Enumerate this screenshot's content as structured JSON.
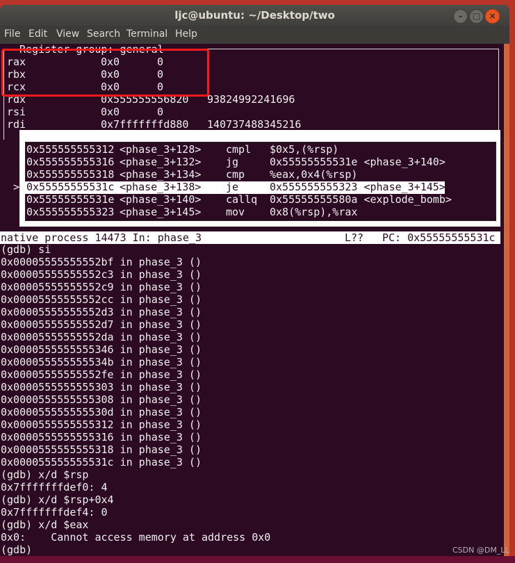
{
  "window": {
    "title": "ljc@ubuntu: ~/Desktop/two",
    "buttons": [
      "minimize",
      "maximize",
      "close"
    ],
    "close_color": "#e95420"
  },
  "menu": [
    "File",
    "Edit",
    "View",
    "Search",
    "Terminal",
    "Help"
  ],
  "registers": {
    "header": "Register group: general",
    "rows": [
      {
        "name": "rax",
        "hex": "0x0",
        "dec": "0"
      },
      {
        "name": "rbx",
        "hex": "0x0",
        "dec": "0"
      },
      {
        "name": "rcx",
        "hex": "0x0",
        "dec": "0"
      },
      {
        "name": "rdx",
        "hex": "0x555555556820",
        "dec": "93824992241696"
      },
      {
        "name": "rsi",
        "hex": "0x0",
        "dec": "0"
      },
      {
        "name": "rdi",
        "hex": "0x7fffffffd880",
        "dec": "140737488345216"
      }
    ],
    "highlight_color": "#ff1a1a"
  },
  "disasm": {
    "marker": ">",
    "current_index": 3,
    "rows": [
      {
        "addr": "0x555555555312",
        "sym": "<phase_3+128>",
        "op": "cmpl",
        "args": "$0x5,(%rsp)"
      },
      {
        "addr": "0x555555555316",
        "sym": "<phase_3+132>",
        "op": "jg",
        "args": "0x55555555531e <phase_3+140>"
      },
      {
        "addr": "0x555555555318",
        "sym": "<phase_3+134>",
        "op": "cmp",
        "args": "%eax,0x4(%rsp)"
      },
      {
        "addr": "0x55555555531c",
        "sym": "<phase_3+138>",
        "op": "je",
        "args": "0x555555555323 <phase_3+145>"
      },
      {
        "addr": "0x55555555531e",
        "sym": "<phase_3+140>",
        "op": "callq",
        "args": "0x55555555580a <explode_bomb>"
      },
      {
        "addr": "0x555555555323",
        "sym": "<phase_3+145>",
        "op": "mov",
        "args": "0x8(%rsp),%rax"
      }
    ]
  },
  "status": {
    "left": "native process 14473 In: phase_3",
    "line": "L??",
    "pc": "PC: 0x55555555531c"
  },
  "console": [
    "(gdb) si",
    "0x00005555555552bf in phase_3 ()",
    "0x00005555555552c3 in phase_3 ()",
    "0x00005555555552c9 in phase_3 ()",
    "0x00005555555552cc in phase_3 ()",
    "0x00005555555552d3 in phase_3 ()",
    "0x00005555555552d7 in phase_3 ()",
    "0x00005555555552da in phase_3 ()",
    "0x0000555555555346 in phase_3 ()",
    "0x000055555555534b in phase_3 ()",
    "0x00005555555552fe in phase_3 ()",
    "0x0000555555555303 in phase_3 ()",
    "0x0000555555555308 in phase_3 ()",
    "0x000055555555530d in phase_3 ()",
    "0x0000555555555312 in phase_3 ()",
    "0x0000555555555316 in phase_3 ()",
    "0x0000555555555318 in phase_3 ()",
    "0x000055555555531c in phase_3 ()",
    "(gdb) x/d $rsp",
    "0x7fffffffdef0: 4",
    "(gdb) x/d $rsp+0x4",
    "0x7fffffffdef4: 0",
    "(gdb) x/d $eax",
    "0x0:    Cannot access memory at address 0x0",
    "(gdb)"
  ],
  "watermark": "CSDN @DM_LL"
}
